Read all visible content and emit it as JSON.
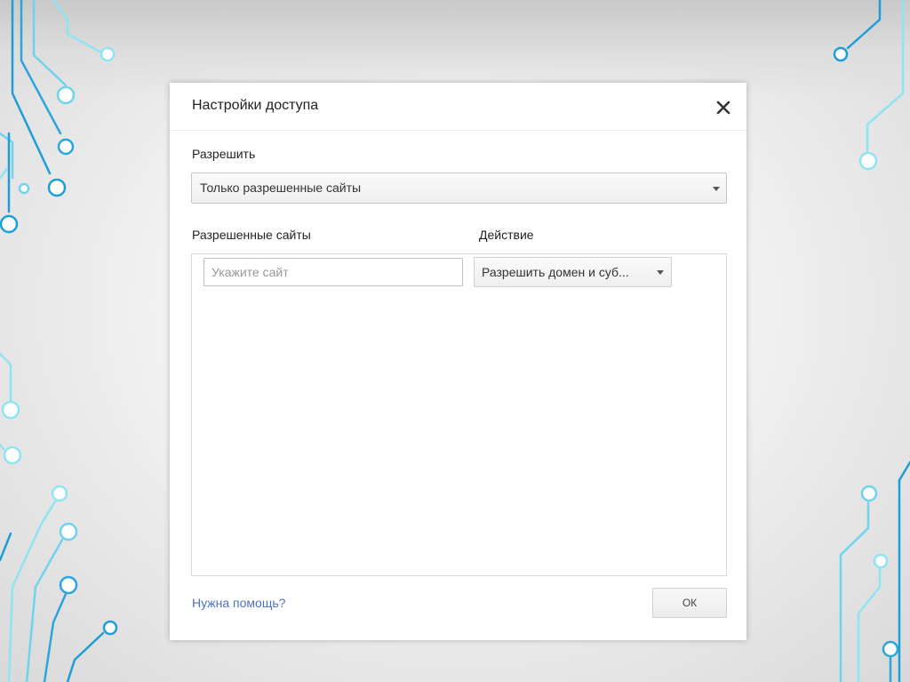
{
  "dialog": {
    "title": "Настройки доступа",
    "close_icon": "close-icon",
    "allow_label": "Разрешить",
    "allow_select_value": "Только разрешенные сайты",
    "sites_column_label": "Разрешенные сайты",
    "action_column_label": "Действие",
    "site_input_value": "",
    "site_input_placeholder": "Укажите сайт",
    "action_select_value": "Разрешить домен и суб...",
    "help_link": "Нужна помощь?",
    "ok_label": "ОК"
  },
  "colors": {
    "circuit_light": "#8fe4f2",
    "circuit_dark": "#1e9ed8",
    "link": "#4a72c6"
  }
}
